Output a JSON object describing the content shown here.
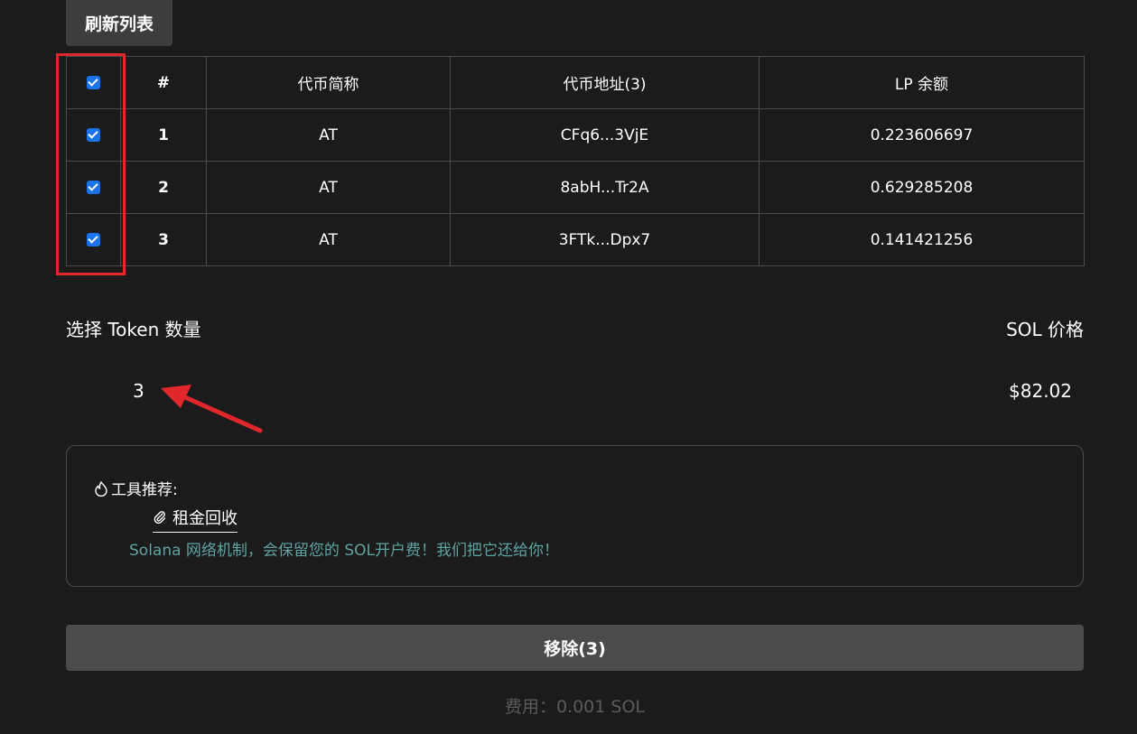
{
  "refresh_button": "刷新列表",
  "table": {
    "headers": {
      "num": "#",
      "symbol": "代币简称",
      "address": "代币地址(3)",
      "balance": "LP 余额"
    },
    "rows": [
      {
        "num": "1",
        "symbol": "AT",
        "address": "CFq6...3VjE",
        "balance": "0.223606697",
        "checked": true
      },
      {
        "num": "2",
        "symbol": "AT",
        "address": "8abH...Tr2A",
        "balance": "0.629285208",
        "checked": true
      },
      {
        "num": "3",
        "symbol": "AT",
        "address": "3FTk...Dpx7",
        "balance": "0.141421256",
        "checked": true
      }
    ],
    "select_all_checked": true
  },
  "summary": {
    "select_label": "选择 Token 数量",
    "select_count": "3",
    "sol_label": "SOL 价格",
    "sol_price": "$82.02"
  },
  "tool": {
    "title": "工具推荐:",
    "title_icon": "flame-icon",
    "link_label": "租金回收",
    "link_icon": "paperclip-icon",
    "description": "Solana 网络机制，会保留您的 SOL开户费！我们把它还给你！"
  },
  "remove_button": "移除(3)",
  "fee": "费用：0.001 SOL",
  "colors": {
    "background": "#1b1b1b",
    "checkbox": "#1a73e8",
    "annotation": "#e0282c",
    "teal_text": "#5fa3a0"
  }
}
